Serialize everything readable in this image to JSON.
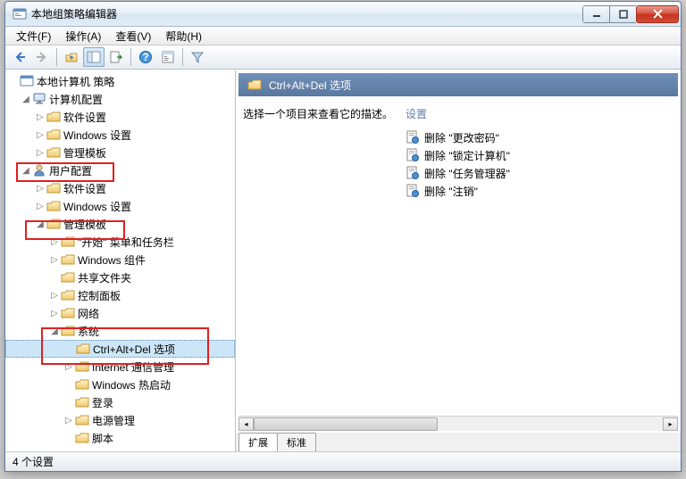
{
  "window": {
    "title": "本地组策略编辑器"
  },
  "menu": {
    "file": "文件(F)",
    "action": "操作(A)",
    "view": "查看(V)",
    "help": "帮助(H)"
  },
  "tree": {
    "root": "本地计算机 策略",
    "computer_cfg": "计算机配置",
    "cc_software": "软件设置",
    "cc_windows": "Windows 设置",
    "cc_admin": "管理模板",
    "user_cfg": "用户配置",
    "uc_software": "软件设置",
    "uc_windows": "Windows 设置",
    "uc_admin": "管理模板",
    "start_taskbar": "\"开始\" 菜单和任务栏",
    "win_components": "Windows 组件",
    "shared_folders": "共享文件夹",
    "control_panel": "控制面板",
    "network": "网络",
    "system": "系统",
    "ctrl_alt_del": "Ctrl+Alt+Del 选项",
    "internet_mgmt": "Internet 通信管理",
    "win_hotstart": "Windows 热启动",
    "logon": "登录",
    "power_mgmt": "电源管理",
    "scripts": "脚本"
  },
  "right": {
    "header": "Ctrl+Alt+Del 选项",
    "desc_prompt": "选择一个项目来查看它的描述。",
    "settings_head": "设置",
    "items": [
      "删除 \"更改密码\"",
      "删除 \"锁定计算机\"",
      "删除 \"任务管理器\"",
      "删除 \"注销\""
    ],
    "tab_ext": "扩展",
    "tab_std": "标准"
  },
  "status": "4 个设置"
}
